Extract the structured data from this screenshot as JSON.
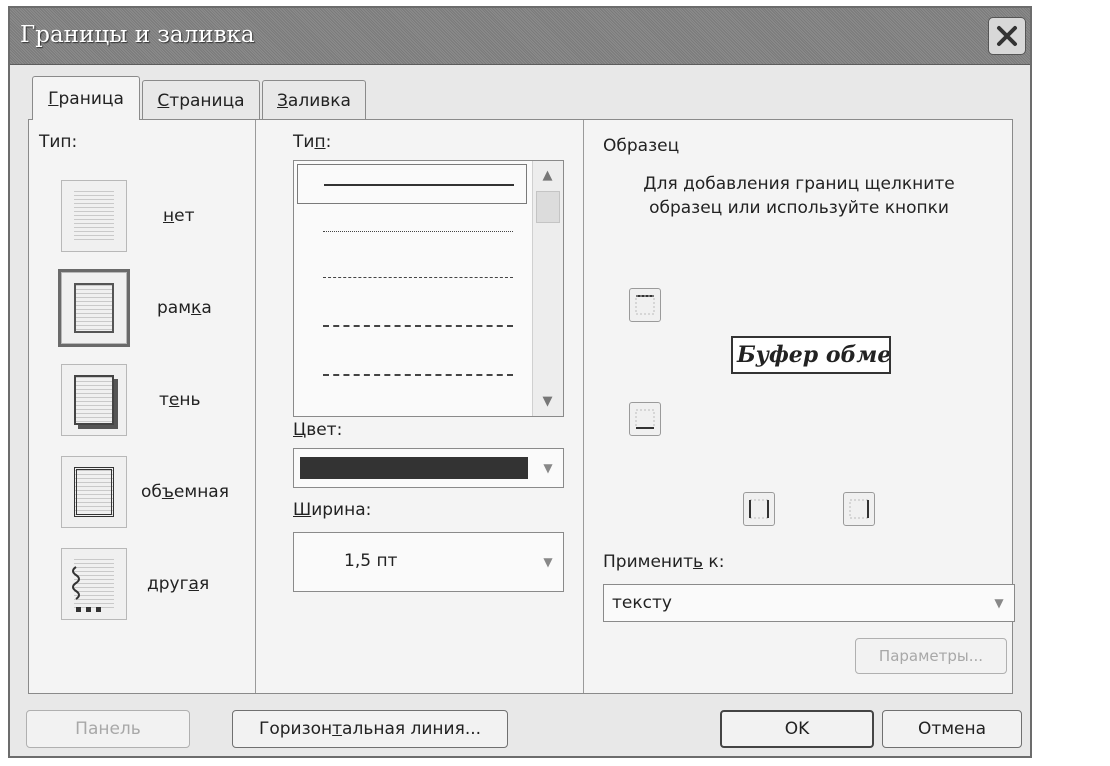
{
  "dialog": {
    "title": "Границы и заливка",
    "close_icon": "close-icon"
  },
  "tabs": [
    {
      "label": "Граница",
      "underline": "Г",
      "rest": "раница",
      "active": true
    },
    {
      "label": "Страница",
      "underline": "С",
      "rest": "траница",
      "active": false
    },
    {
      "label": "Заливка",
      "underline": "З",
      "rest": "аливка",
      "active": false
    }
  ],
  "setting": {
    "label": "Тип:",
    "options": [
      {
        "pre": "",
        "u": "н",
        "post": "ет",
        "icon": "no-border-icon"
      },
      {
        "pre": "рам",
        "u": "к",
        "post": "а",
        "icon": "box-border-icon",
        "selected": true
      },
      {
        "pre": "т",
        "u": "е",
        "post": "нь",
        "icon": "shadow-border-icon"
      },
      {
        "pre": "об",
        "u": "ъ",
        "post": "емная",
        "icon": "3d-border-icon"
      },
      {
        "pre": "друг",
        "u": "а",
        "post": "я",
        "icon": "custom-border-icon"
      }
    ]
  },
  "style": {
    "label_pre": "Ти",
    "label_u": "п",
    "label_post": ":",
    "line_styles": [
      "solid",
      "dotted",
      "dashed-fine",
      "dashed",
      "dash-dot"
    ]
  },
  "color": {
    "label_u": "Ц",
    "label_rest": "вет:",
    "value": "#333333"
  },
  "width": {
    "label_u": "Ш",
    "label_rest": "ирина:",
    "value": "1,5 пт"
  },
  "preview": {
    "label": "Образец",
    "hint_line1": "Для добавления границ щелкните",
    "hint_line2": "образец или используйте кнопки",
    "sample_text": "Буфер обме"
  },
  "apply_to": {
    "label_pre": "Применит",
    "label_u": "ь",
    "label_post": " к:",
    "value": "тексту"
  },
  "buttons": {
    "options": "Параметры...",
    "show_toolbar": "Панель",
    "horizontal_line_pre": "Горизон",
    "horizontal_line_u": "т",
    "horizontal_line_post": "альная линия...",
    "ok": "OK",
    "cancel": "Отмена"
  }
}
